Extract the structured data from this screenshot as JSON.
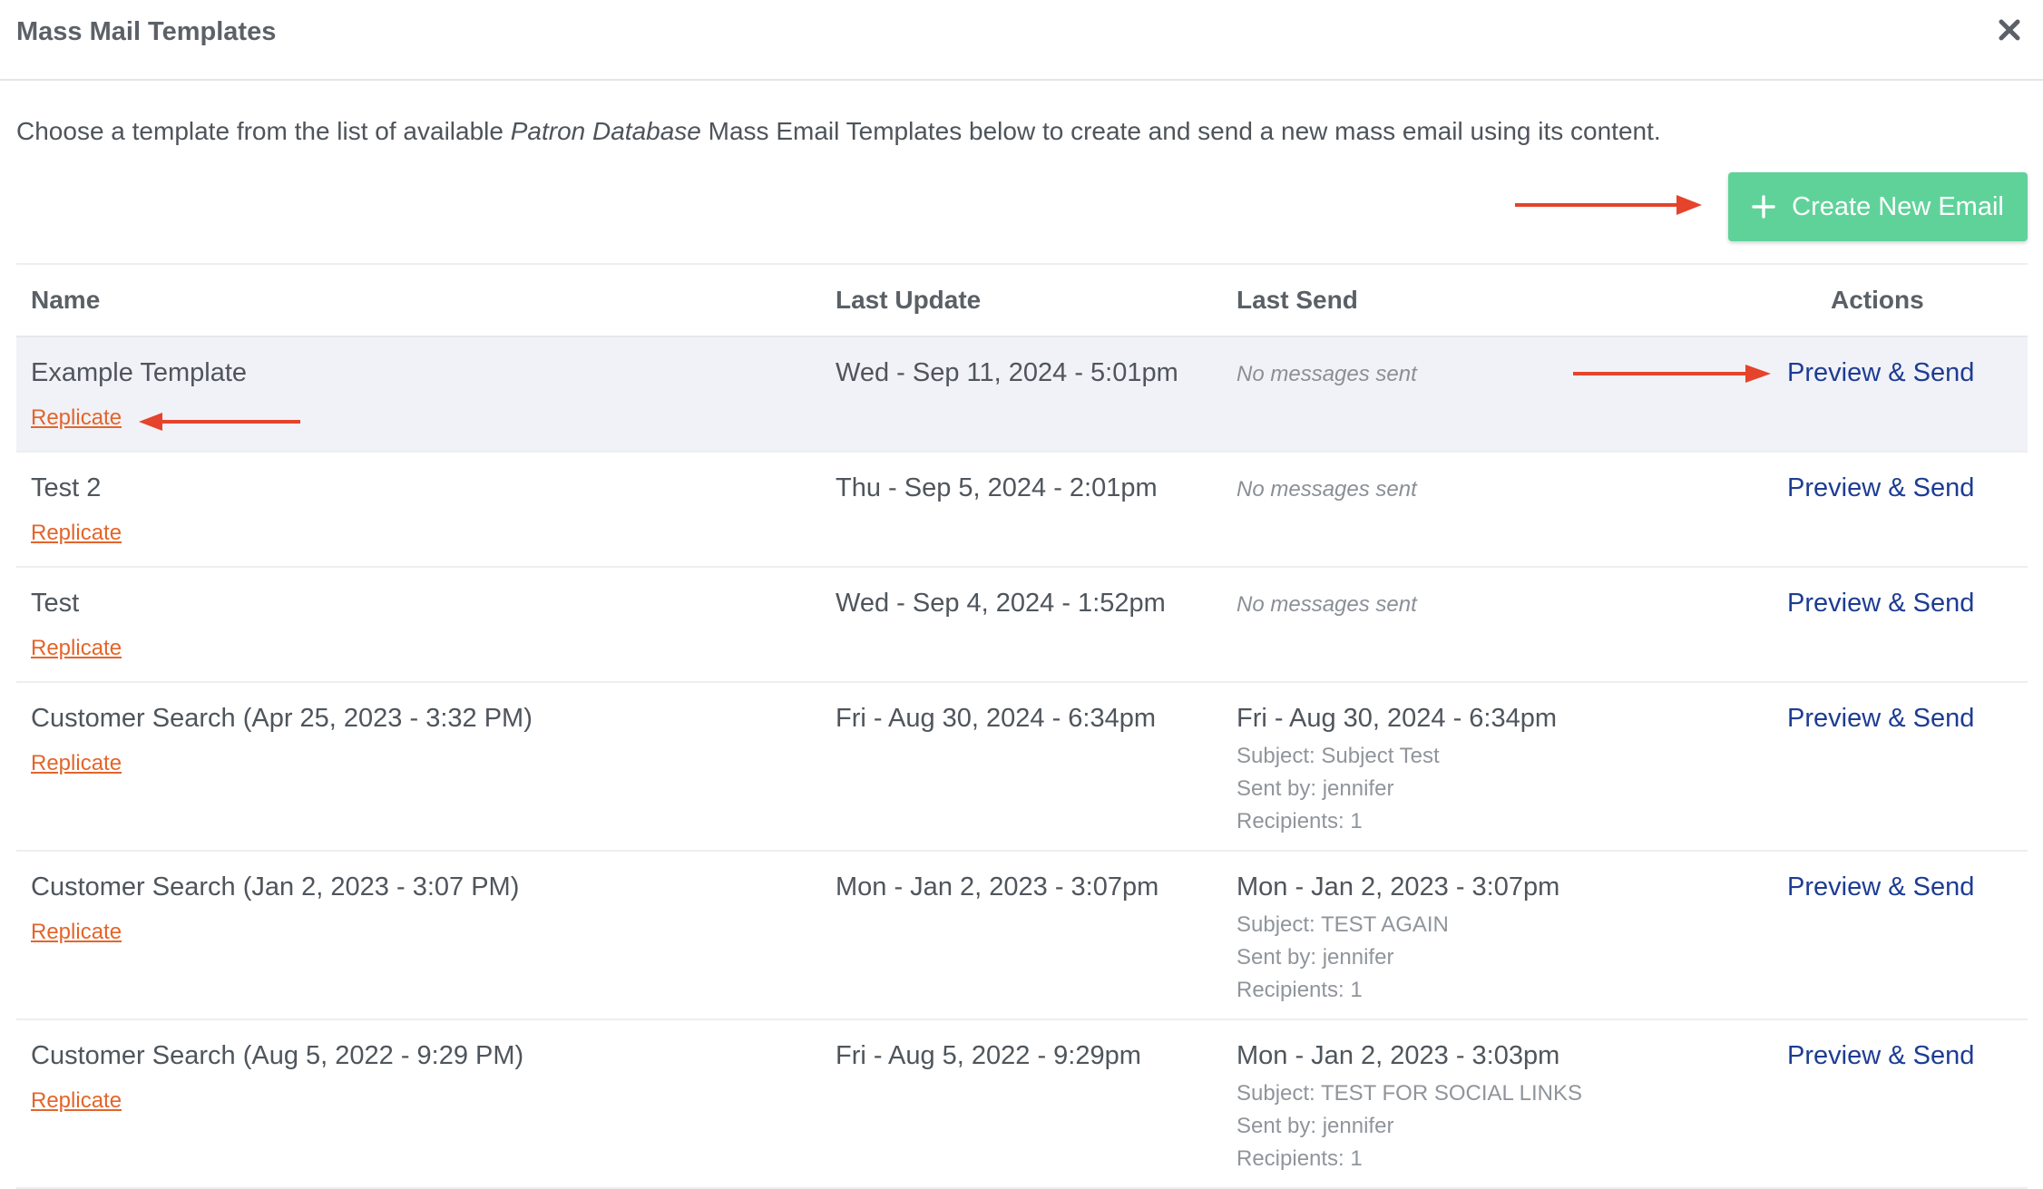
{
  "header": {
    "title": "Mass Mail Templates"
  },
  "intro": {
    "before": "Choose a template from the list of available ",
    "emphasis": "Patron Database",
    "after": " Mass Email Templates below to create and send a new mass email using its content."
  },
  "create_button": {
    "label": "Create New Email",
    "icon": "plus-icon"
  },
  "table": {
    "headers": {
      "name": "Name",
      "last_update": "Last Update",
      "last_send": "Last Send",
      "actions": "Actions"
    },
    "rows": [
      {
        "name": "Example Template",
        "replicate": "Replicate",
        "last_update": "Wed - Sep 11, 2024 - 5:01pm",
        "no_messages": "No messages sent",
        "action": "Preview & Send"
      },
      {
        "name": "Test 2",
        "replicate": "Replicate",
        "last_update": "Thu - Sep 5, 2024 - 2:01pm",
        "no_messages": "No messages sent",
        "action": "Preview & Send"
      },
      {
        "name": "Test",
        "replicate": "Replicate",
        "last_update": "Wed - Sep 4, 2024 - 1:52pm",
        "no_messages": "No messages sent",
        "action": "Preview & Send"
      },
      {
        "name": "Customer Search (Apr 25, 2023 - 3:32 PM)",
        "replicate": "Replicate",
        "last_update": "Fri - Aug 30, 2024 - 6:34pm",
        "send_date": "Fri - Aug 30, 2024 - 6:34pm",
        "subject": "Subject: Subject Test",
        "sent_by": "Sent by: jennifer",
        "recipients": "Recipients: 1",
        "action": "Preview & Send"
      },
      {
        "name": "Customer Search (Jan 2, 2023 - 3:07 PM)",
        "replicate": "Replicate",
        "last_update": "Mon - Jan 2, 2023 - 3:07pm",
        "send_date": "Mon - Jan 2, 2023 - 3:07pm",
        "subject": "Subject: TEST AGAIN",
        "sent_by": "Sent by: jennifer",
        "recipients": "Recipients: 1",
        "action": "Preview & Send"
      },
      {
        "name": "Customer Search (Aug 5, 2022 - 9:29 PM)",
        "replicate": "Replicate",
        "last_update": "Fri - Aug 5, 2022 - 9:29pm",
        "send_date": "Mon - Jan 2, 2023 - 3:03pm",
        "subject": "Subject: TEST FOR SOCIAL LINKS",
        "sent_by": "Sent by: jennifer",
        "recipients": "Recipients: 1",
        "action": "Preview & Send"
      }
    ]
  },
  "colors": {
    "accent_button": "#5fd29a",
    "link_orange": "#e3652a",
    "link_blue": "#1d3c93",
    "annotation_arrow": "#e5432c",
    "highlight_row": "#f1f2f7"
  }
}
